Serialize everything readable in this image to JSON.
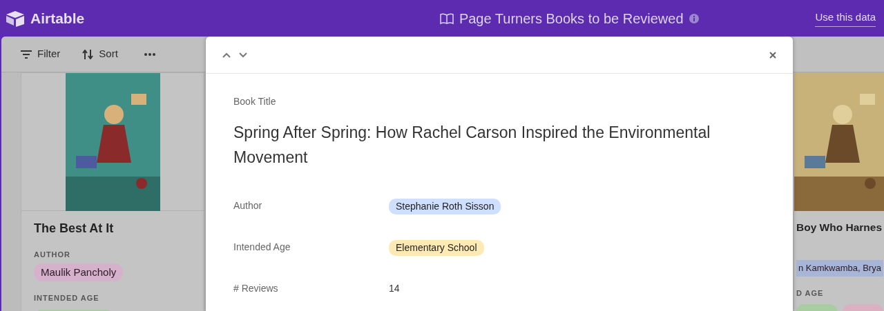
{
  "header": {
    "logo": "Airtable",
    "title": "Page Turners Books to be Reviewed",
    "link": "Use this data"
  },
  "toolbar": {
    "buttons": [
      {
        "kind": "filter",
        "label": "Filter"
      },
      {
        "kind": "sort",
        "label": "Sort"
      },
      {
        "kind": "more"
      }
    ]
  },
  "gallery": {
    "cards": [
      {
        "title": "The Best At It",
        "author_label": "AUTHOR",
        "authors": [
          {
            "name": "Maulik Pancholy",
            "color": "#d6b1cb"
          }
        ],
        "age_label": "INTENDED AGE",
        "age_tags": [
          {
            "color": "#a8cda0"
          }
        ]
      },
      {
        "title": "Boy Who Harnes",
        "authors": [
          {
            "name": "n Kamkwamba, Brya",
            "color": "#a7b5d6"
          }
        ],
        "age_label": "D AGE",
        "age_tags": [
          {
            "color": "#a8cda0"
          },
          {
            "color": "#dbb1c2"
          }
        ]
      }
    ]
  },
  "record": {
    "title_label": "Book Title",
    "title": "Spring After Spring: How Rachel Carson Inspired the Environmental Movement",
    "fields": [
      {
        "label": "Author",
        "kind": "tag",
        "value": "Stephanie Roth Sisson",
        "color": "#cfdfff"
      },
      {
        "label": "Intended Age",
        "kind": "tag",
        "value": "Elementary School",
        "color": "#ffeab6"
      },
      {
        "label": "# Reviews",
        "kind": "number",
        "value": "14"
      }
    ]
  }
}
